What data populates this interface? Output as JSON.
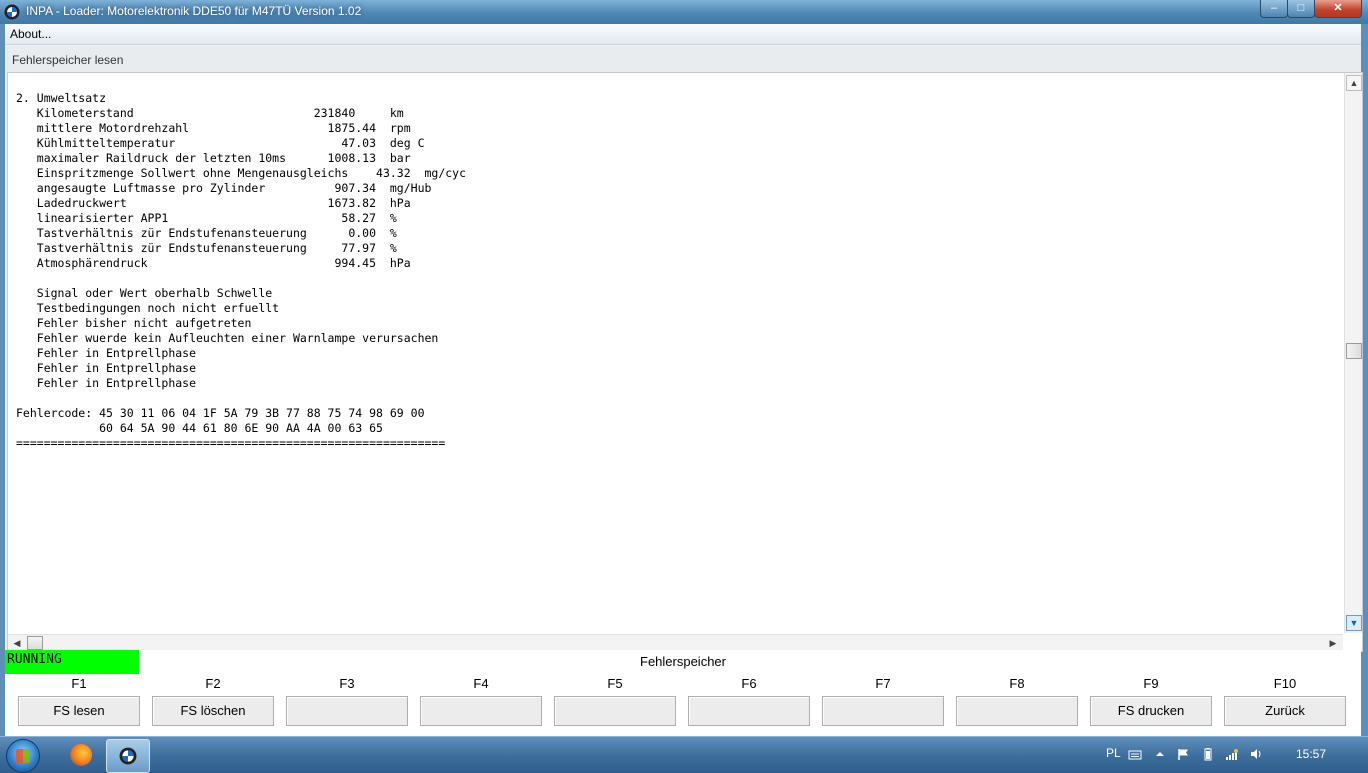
{
  "window": {
    "title": "INPA - Loader:  Motorelektronik DDE50 für M47TÜ Version 1.02",
    "controls": {
      "minimize": "–",
      "maximize": "□",
      "close": "✕"
    }
  },
  "menu": {
    "about": "About..."
  },
  "section": {
    "title": "Fehlerspeicher lesen"
  },
  "output": {
    "lines": [
      "2. Umweltsatz",
      "   Kilometerstand                          231840     km",
      "   mittlere Motordrehzahl                    1875.44  rpm",
      "   Kühlmitteltemperatur                        47.03  deg C",
      "   maximaler Raildruck der letzten 10ms      1008.13  bar",
      "   Einspritzmenge Sollwert ohne Mengenausgleichs    43.32  mg/cyc",
      "   angesaugte Luftmasse pro Zylinder          907.34  mg/Hub",
      "   Ladedruckwert                             1673.82  hPa",
      "   linearisierter APP1                         58.27  %",
      "   Tastverhältnis zür Endstufenansteuerung      0.00  %",
      "   Tastverhältnis zür Endstufenansteuerung     77.97  %",
      "   Atmosphärendruck                           994.45  hPa",
      "",
      "   Signal oder Wert oberhalb Schwelle",
      "   Testbedingungen noch nicht erfuellt",
      "   Fehler bisher nicht aufgetreten",
      "   Fehler wuerde kein Aufleuchten einer Warnlampe verursachen",
      "   Fehler in Entprellphase",
      "   Fehler in Entprellphase",
      "   Fehler in Entprellphase",
      "",
      "Fehlercode: 45 30 11 06 04 1F 5A 79 3B 77 88 75 74 98 69 00",
      "            60 64 5A 90 44 61 80 6E 90 AA 4A 00 63 65",
      "=============================================================="
    ]
  },
  "scrollbars": {
    "up": "▲",
    "down": "▼",
    "left": "◀",
    "right": "▶"
  },
  "status": {
    "state": "RUNNING",
    "title": "Fehlerspeicher",
    "state_color": "#00ff00"
  },
  "fkeys": [
    {
      "key": "F1",
      "label": "FS lesen"
    },
    {
      "key": "F2",
      "label": "FS löschen"
    },
    {
      "key": "F3",
      "label": ""
    },
    {
      "key": "F4",
      "label": ""
    },
    {
      "key": "F5",
      "label": ""
    },
    {
      "key": "F6",
      "label": ""
    },
    {
      "key": "F7",
      "label": ""
    },
    {
      "key": "F8",
      "label": ""
    },
    {
      "key": "F9",
      "label": "FS drucken"
    },
    {
      "key": "F10",
      "label": "Zurück"
    }
  ],
  "taskbar": {
    "language": "PL",
    "clock": "15:57"
  }
}
